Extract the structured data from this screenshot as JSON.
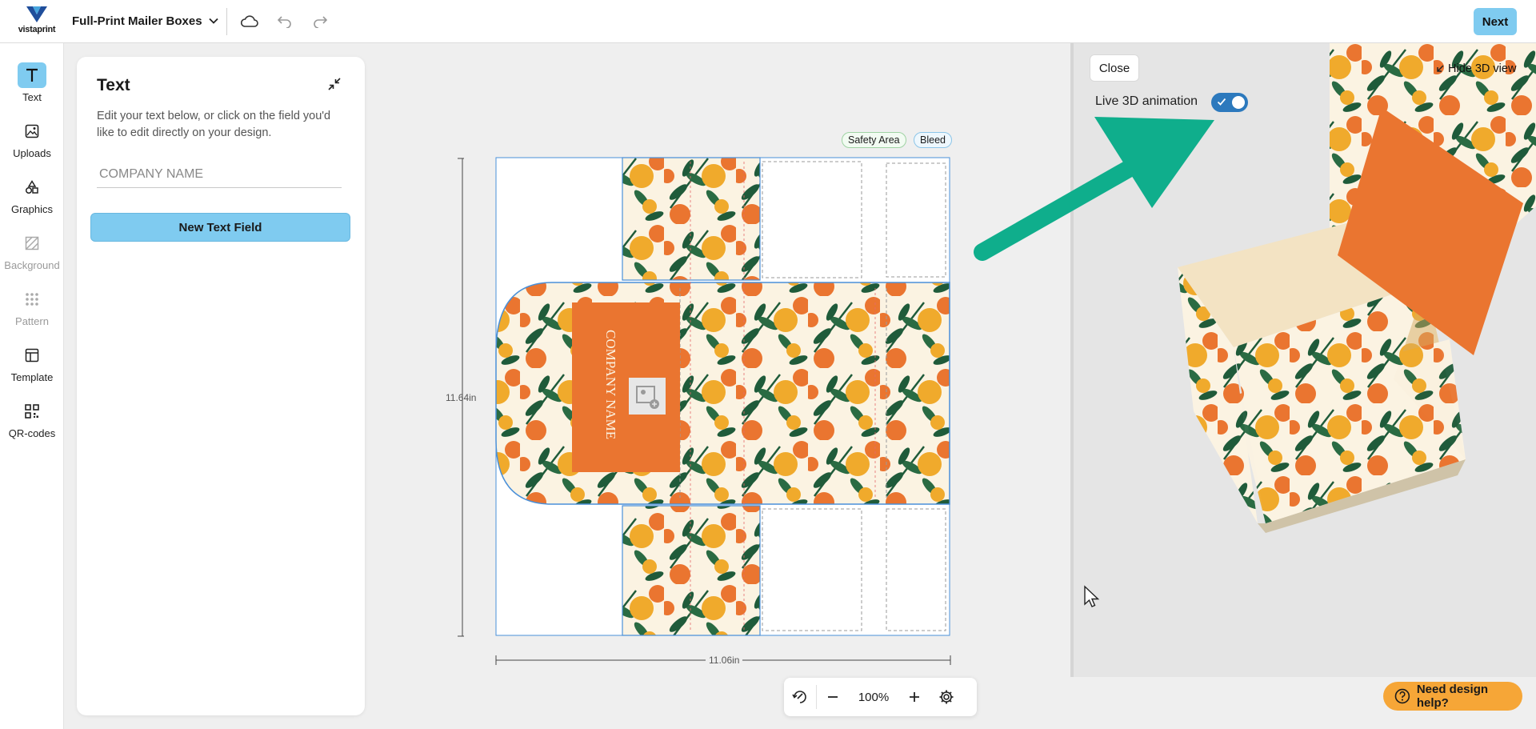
{
  "header": {
    "logo_text": "vistaprint",
    "product_name": "Full-Print Mailer Boxes",
    "next_label": "Next"
  },
  "rail": {
    "items": [
      {
        "label": "Text",
        "icon": "text-icon",
        "active": true
      },
      {
        "label": "Uploads",
        "icon": "image-upload-icon"
      },
      {
        "label": "Graphics",
        "icon": "shapes-icon"
      },
      {
        "label": "Background",
        "icon": "background-icon",
        "disabled": true
      },
      {
        "label": "Pattern",
        "icon": "pattern-icon",
        "disabled": true
      },
      {
        "label": "Template",
        "icon": "template-icon"
      },
      {
        "label": "QR-codes",
        "icon": "qr-code-icon"
      }
    ]
  },
  "panel": {
    "title": "Text",
    "description": "Edit your text below, or click on the field you'd like to edit directly on your design.",
    "input_placeholder": "COMPANY NAME",
    "new_text_label": "New Text Field"
  },
  "canvas": {
    "safety_area_label": "Safety Area",
    "bleed_label": "Bleed",
    "height_label": "11.64in",
    "width_label": "11.06in",
    "design_text": "COMPANY NAME"
  },
  "zoom": {
    "value": "100%"
  },
  "view3d": {
    "close_label": "Close",
    "live_animation_label": "Live 3D animation",
    "live_animation_on": true,
    "hide_label": "Hide 3D view"
  },
  "help": {
    "label": "Need design help?"
  },
  "colors": {
    "accent": "#7fcbf0",
    "toggle_on": "#2c79bd",
    "pattern_orange": "#ea7530",
    "pattern_yellow": "#f0aa2c",
    "pattern_leaf": "#1f5b3a",
    "pattern_bg": "#fbf3e2",
    "annotation_arrow": "#0fae8c",
    "help_button": "#f6a637"
  }
}
